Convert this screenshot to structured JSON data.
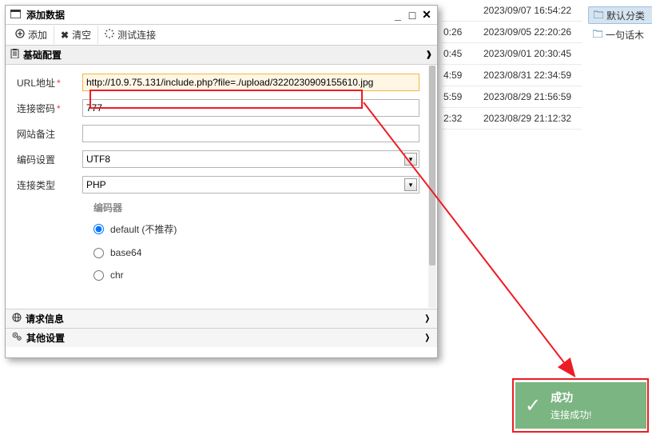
{
  "dialog": {
    "title": "添加数据",
    "toolbar": {
      "add": "添加",
      "clear": "清空",
      "test": "测试连接"
    },
    "sections": {
      "basic": "基础配置",
      "request": "请求信息",
      "other": "其他设置"
    },
    "form": {
      "url_label": "URL地址",
      "url_value": "http://10.9.75.131/include.php?file=./upload/3220230909155610.jpg",
      "pwd_label": "连接密码",
      "pwd_value": "777",
      "note_label": "网站备注",
      "note_value": "",
      "enc_label": "编码设置",
      "enc_value": "UTF8",
      "type_label": "连接类型",
      "type_value": "PHP",
      "encoder_title": "编码器",
      "encoder_opts": {
        "default": "default (不推荐)",
        "base64": "base64",
        "chr": "chr"
      }
    }
  },
  "bg_rows": [
    {
      "c1": "",
      "c2": "2023/09/07 16:54:22"
    },
    {
      "c1": "0:26",
      "c2": "2023/09/05 22:20:26"
    },
    {
      "c1": "0:45",
      "c2": "2023/09/01 20:30:45"
    },
    {
      "c1": "4:59",
      "c2": "2023/08/31 22:34:59"
    },
    {
      "c1": "5:59",
      "c2": "2023/08/29 21:56:59"
    },
    {
      "c1": "2:32",
      "c2": "2023/08/29 21:12:32"
    }
  ],
  "sidebar": {
    "default_cat": "默认分类",
    "other_cat": "一句话木"
  },
  "toast": {
    "title": "成功",
    "msg": "连接成功!"
  }
}
